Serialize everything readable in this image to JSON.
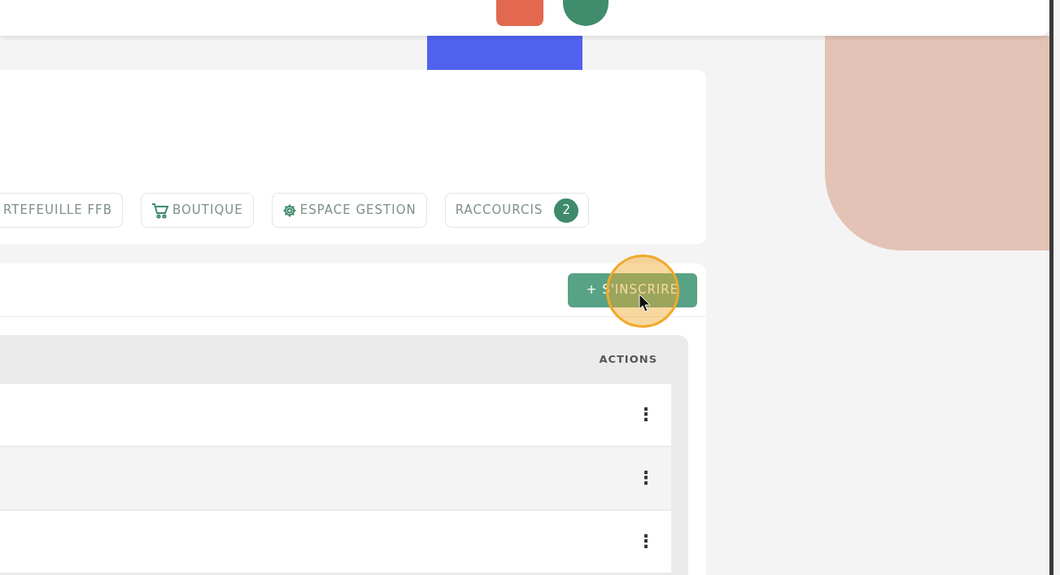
{
  "toolbar": [
    {
      "kind": "plain",
      "label": "RTEFEUILLE FFB"
    },
    {
      "kind": "cart",
      "label": "BOUTIQUE"
    },
    {
      "kind": "gear",
      "label": "ESPACE GESTION"
    },
    {
      "kind": "count",
      "label": "RACCOURCIS",
      "count": "2"
    }
  ],
  "register_button": {
    "label": "+ S'INSCRIRE"
  },
  "table": {
    "columns": [
      "ACTIONS"
    ],
    "rows": [
      {
        "action": "⋮"
      },
      {
        "action": "⋮"
      },
      {
        "action": "⋮"
      }
    ]
  }
}
